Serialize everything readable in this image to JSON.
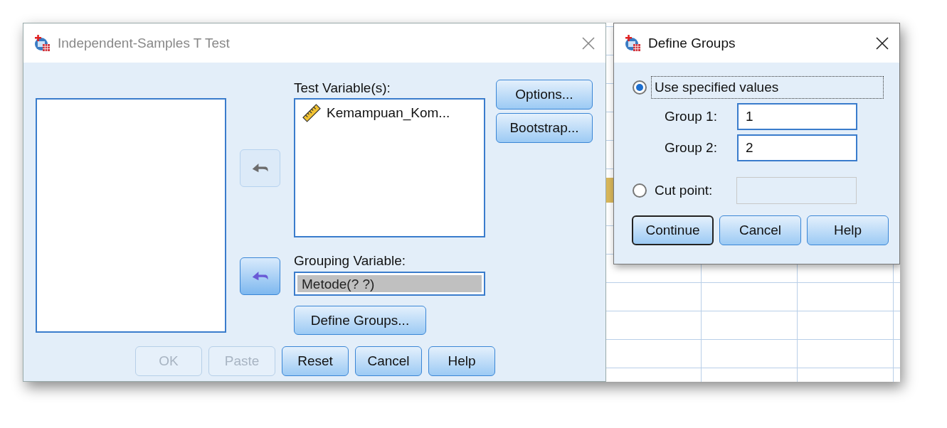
{
  "main_dialog": {
    "title": "Independent-Samples T Test",
    "test_variables_label": "Test Variable(s):",
    "test_variables": [
      {
        "name": "Kemampuan_Kom...",
        "kind": "scale"
      }
    ],
    "move_buttons": [
      {
        "disabled": true
      },
      {
        "disabled": false
      }
    ],
    "grouping_variable_label": "Grouping Variable:",
    "grouping_variable": "Metode(? ?)",
    "define_groups_button": "Define Groups...",
    "side_buttons": [
      {
        "label": "Options..."
      },
      {
        "label": "Bootstrap..."
      }
    ],
    "buttons": [
      {
        "label": "OK",
        "disabled": true
      },
      {
        "label": "Paste",
        "disabled": true
      },
      {
        "label": "Reset",
        "disabled": false
      },
      {
        "label": "Cancel",
        "disabled": false
      },
      {
        "label": "Help",
        "disabled": false
      }
    ]
  },
  "define_groups_dialog": {
    "title": "Define Groups",
    "options": [
      {
        "kind": "values",
        "label": "Use specified values",
        "selected": true,
        "focused": true,
        "fields": [
          {
            "label": "Group 1:",
            "value": "1"
          },
          {
            "label": "Group 2:",
            "value": "2"
          }
        ]
      },
      {
        "kind": "cut_point",
        "label": "Cut point:",
        "selected": false,
        "focused": false,
        "field_disabled": true
      }
    ],
    "buttons": [
      {
        "label": "Continue",
        "default": true
      },
      {
        "label": "Cancel",
        "default": false
      },
      {
        "label": "Help",
        "default": false
      }
    ]
  }
}
